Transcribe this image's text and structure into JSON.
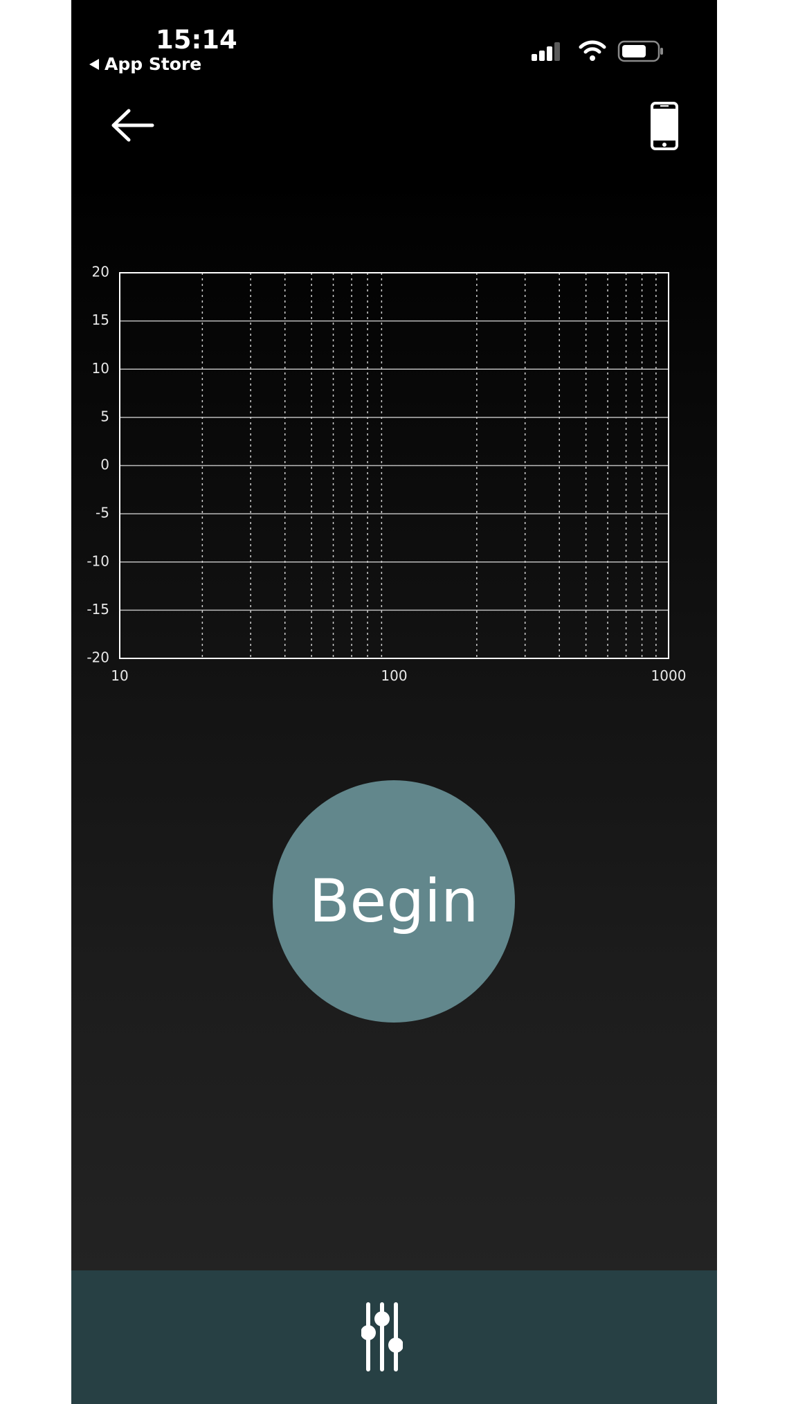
{
  "status_bar": {
    "time": "15:14",
    "back_app_label": "App Store",
    "icons": [
      "cellular-signal-icon",
      "wifi-icon",
      "battery-icon"
    ]
  },
  "nav": {
    "back_icon": "arrow-left-icon",
    "device_icon": "smartphone-icon"
  },
  "chart_data": {
    "type": "line",
    "series": [],
    "x_scale": "log",
    "xlim": [
      10,
      1000
    ],
    "ylim": [
      -20,
      20
    ],
    "x_ticks": [
      "10",
      "100",
      "1000"
    ],
    "y_ticks": [
      "20",
      "15",
      "10",
      "5",
      "0",
      "-5",
      "-10",
      "-15",
      "-20"
    ],
    "x_minor_grid": [
      20,
      30,
      40,
      50,
      60,
      70,
      80,
      90,
      200,
      300,
      400,
      500,
      600,
      700,
      800,
      900
    ],
    "y_grid": [
      15,
      10,
      5,
      0,
      -5,
      -10,
      -15
    ],
    "grid": true,
    "title": "",
    "xlabel": "",
    "ylabel": ""
  },
  "begin_button": {
    "label": "Begin",
    "color": "#62878c"
  },
  "tab_bar": {
    "icon": "equalizer-sliders-icon",
    "background": "#274044"
  }
}
